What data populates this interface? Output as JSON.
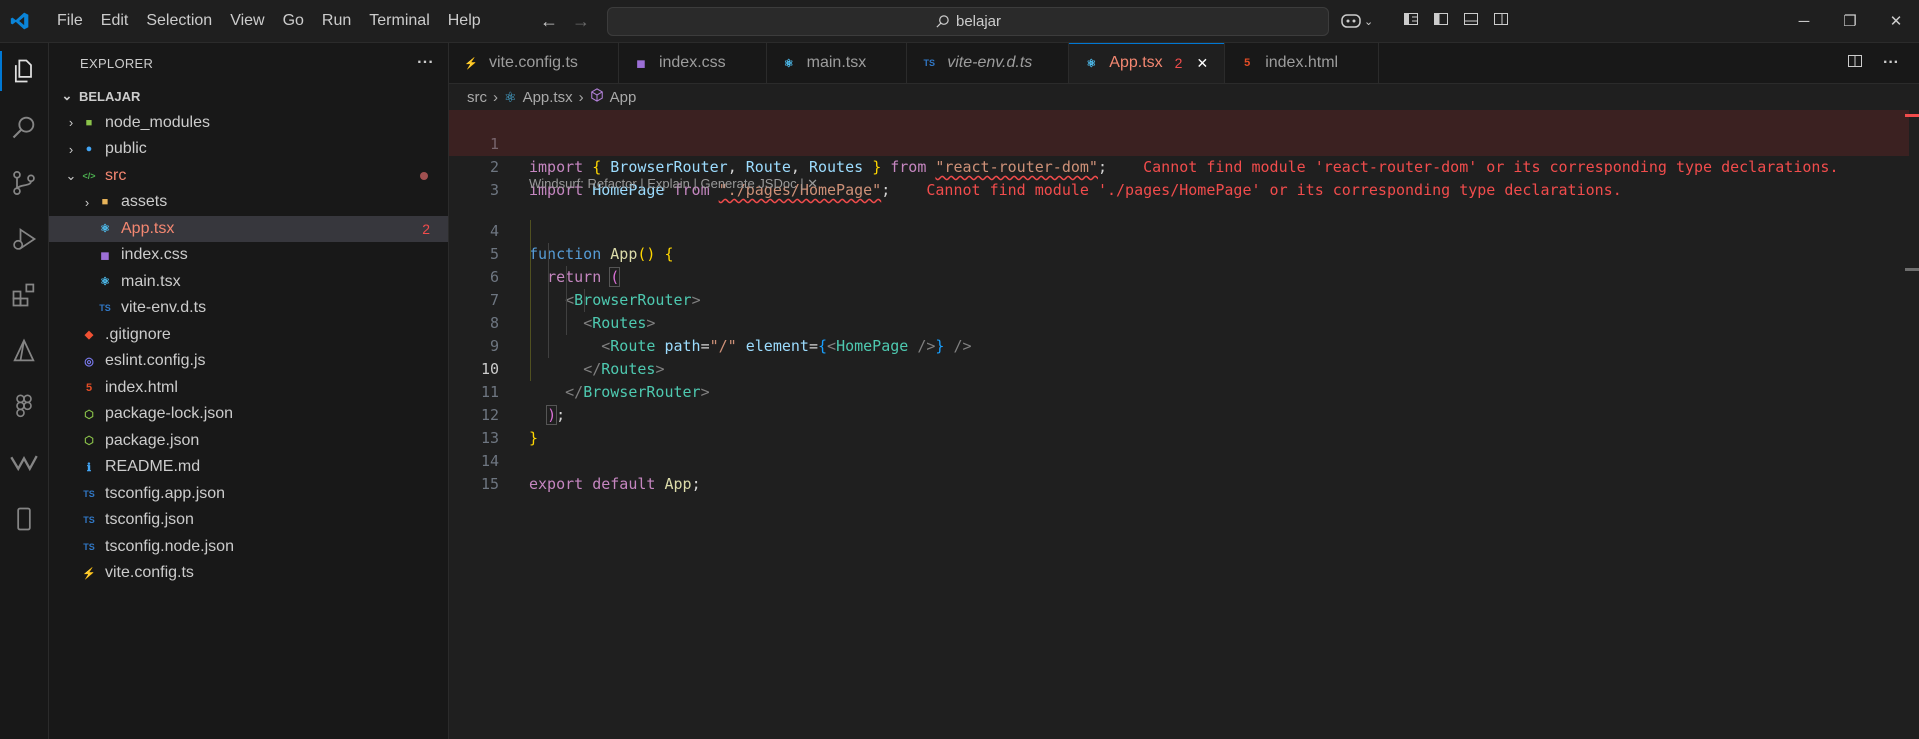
{
  "title_bar": {
    "menu": [
      "File",
      "Edit",
      "Selection",
      "View",
      "Go",
      "Run",
      "Terminal",
      "Help"
    ],
    "search_text": "belajar"
  },
  "activity_bar": [
    "explorer-icon",
    "search-icon",
    "source-control-icon",
    "run-debug-icon",
    "extensions-icon",
    "testing-icon",
    "figma-icon",
    "windsurf-icon",
    "mobile-icon"
  ],
  "explorer": {
    "header": "EXPLORER",
    "more": "···",
    "root": "BELAJAR",
    "items": [
      {
        "label": "node_modules",
        "icon": "folder-node-icon",
        "chevron": "›",
        "depth": 1,
        "color": "#cccccc"
      },
      {
        "label": "public",
        "icon": "folder-public-icon",
        "chevron": "›",
        "depth": 1,
        "color": "#cccccc"
      },
      {
        "label": "src",
        "icon": "folder-src-icon",
        "chevron": "⌄",
        "depth": 1,
        "color": "#f48771"
      },
      {
        "label": "assets",
        "icon": "folder-icon",
        "chevron": "›",
        "depth": 2,
        "color": "#cccccc"
      },
      {
        "label": "App.tsx",
        "icon": "react-icon",
        "chevron": "",
        "depth": 2,
        "color": "#f48771",
        "badge": "2",
        "selected": true
      },
      {
        "label": "index.css",
        "icon": "css-icon",
        "chevron": "",
        "depth": 2,
        "color": "#cccccc"
      },
      {
        "label": "main.tsx",
        "icon": "react-icon",
        "chevron": "",
        "depth": 2,
        "color": "#cccccc"
      },
      {
        "label": "vite-env.d.ts",
        "icon": "ts-icon",
        "chevron": "",
        "depth": 2,
        "color": "#cccccc"
      },
      {
        "label": ".gitignore",
        "icon": "git-icon",
        "chevron": "",
        "depth": 1,
        "color": "#cccccc"
      },
      {
        "label": "eslint.config.js",
        "icon": "eslint-icon",
        "chevron": "",
        "depth": 1,
        "color": "#cccccc"
      },
      {
        "label": "index.html",
        "icon": "html-icon",
        "chevron": "",
        "depth": 1,
        "color": "#cccccc"
      },
      {
        "label": "package-lock.json",
        "icon": "node-json-icon",
        "chevron": "",
        "depth": 1,
        "color": "#cccccc"
      },
      {
        "label": "package.json",
        "icon": "node-json-icon",
        "chevron": "",
        "depth": 1,
        "color": "#cccccc"
      },
      {
        "label": "README.md",
        "icon": "info-icon",
        "chevron": "",
        "depth": 1,
        "color": "#cccccc"
      },
      {
        "label": "tsconfig.app.json",
        "icon": "tsconfig-icon",
        "chevron": "",
        "depth": 1,
        "color": "#cccccc"
      },
      {
        "label": "tsconfig.json",
        "icon": "tsconfig-icon",
        "chevron": "",
        "depth": 1,
        "color": "#cccccc"
      },
      {
        "label": "tsconfig.node.json",
        "icon": "tsconfig-icon",
        "chevron": "",
        "depth": 1,
        "color": "#cccccc"
      },
      {
        "label": "vite.config.ts",
        "icon": "vite-icon",
        "chevron": "",
        "depth": 1,
        "color": "#cccccc"
      }
    ]
  },
  "tabs": [
    {
      "label": "vite.config.ts",
      "icon": "vite-icon"
    },
    {
      "label": "index.css",
      "icon": "css-icon"
    },
    {
      "label": "main.tsx",
      "icon": "react-icon"
    },
    {
      "label": "vite-env.d.ts",
      "icon": "ts-icon",
      "italic": true
    },
    {
      "label": "App.tsx",
      "icon": "react-icon",
      "badge": "2",
      "active": true
    },
    {
      "label": "index.html",
      "icon": "html-icon"
    }
  ],
  "breadcrumb": [
    "src",
    "App.tsx",
    "App"
  ],
  "codelens": "Windsurf: Refactor | Explain | Generate JSDoc | ✕",
  "line_numbers": [
    "1",
    "2",
    "3",
    "4",
    "5",
    "6",
    "7",
    "8",
    "9",
    "10",
    "11",
    "12",
    "13",
    "14",
    "15"
  ],
  "current_line": "10",
  "errors": {
    "line1": "Cannot find module 'react-router-dom' or its corresponding type declarations.",
    "line2": "Cannot find module './pages/HomePage' or its corresponding type declarations."
  },
  "code": {
    "l1": [
      "import",
      "{",
      "BrowserRouter",
      ",",
      "Route",
      ",",
      "Routes",
      "}",
      "from",
      "\"react-router-dom\"",
      ";"
    ],
    "l2": [
      "import",
      "HomePage",
      "from",
      "\"./pages/HomePage\"",
      ";"
    ],
    "l4": [
      "function",
      "App",
      "()",
      "{"
    ],
    "l5": [
      "return",
      "("
    ],
    "l6": [
      "<",
      "BrowserRouter",
      ">"
    ],
    "l7": [
      "<",
      "Routes",
      ">"
    ],
    "l8": [
      "<",
      "Route",
      "path",
      "=",
      "\"/\"",
      "element",
      "=",
      "{",
      "<",
      "HomePage",
      "/>",
      "}",
      "/>"
    ],
    "l9": [
      "</",
      "Routes",
      ">"
    ],
    "l10": [
      "</",
      "BrowserRouter",
      ">"
    ],
    "l11": [
      ")",
      ";"
    ],
    "l12": [
      "}"
    ],
    "l14": [
      "export",
      "default",
      "App",
      ";"
    ]
  }
}
